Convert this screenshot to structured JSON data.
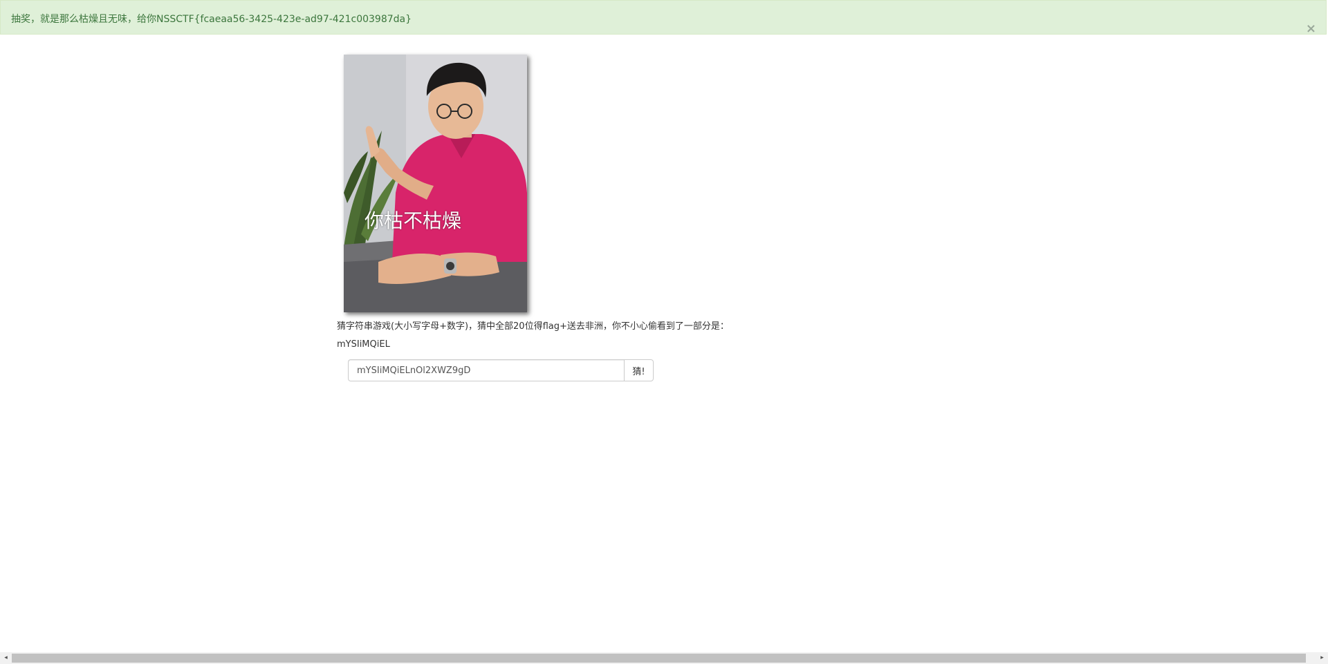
{
  "alert": {
    "message": "抽奖，就是那么枯燥且无味，给你NSSCTF{fcaeaa56-3425-423e-ad97-421c003987da}",
    "close_glyph": "×"
  },
  "meme": {
    "caption": "你枯不枯燥"
  },
  "game": {
    "instructions": "猜字符串游戏(大小写字母+数字)，猜中全部20位得flag+送去非洲，你不小心偷看到了一部分是：",
    "partial": "mYSIiMQiEL"
  },
  "form": {
    "input_value": "mYSIiMQiELnOl2XWZ9gD",
    "button_label": "猜!"
  },
  "scrollbar": {
    "left_glyph": "◂",
    "right_glyph": "▸"
  },
  "colors": {
    "alert_bg": "#dff0d8",
    "alert_text": "#3c763d",
    "shirt": "#d8246a"
  }
}
